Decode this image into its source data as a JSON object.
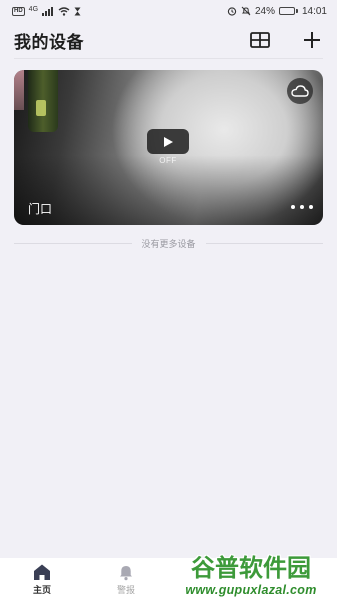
{
  "status_bar": {
    "network_badge": "HD",
    "signal_text": "4G",
    "battery": "24%",
    "battery_level": 0.24,
    "time": "14:01",
    "icons": [
      "hd-icon",
      "signal-icon",
      "wifi-icon",
      "hourglass-icon",
      "alarm-icon",
      "mute-icon",
      "battery-icon"
    ]
  },
  "header": {
    "title": "我的设备",
    "actions": [
      "grid-view-icon",
      "add-icon"
    ]
  },
  "device": {
    "name": "门口",
    "status": "OFF",
    "icons": [
      "cloud-icon",
      "play-icon",
      "more-icon"
    ]
  },
  "list_footer": {
    "text": "没有更多设备"
  },
  "bottom_nav": {
    "items": [
      {
        "label": "主页",
        "icon": "home-icon",
        "active": true
      },
      {
        "label": "警报",
        "icon": "bell-icon",
        "active": false
      }
    ]
  },
  "watermark": {
    "name": "谷普软件园",
    "url": "www.gupuxlazal.com"
  },
  "colors": {
    "background": "#f1f0f6",
    "nav_active": "#333333",
    "nav_inactive": "#a5a5a5",
    "watermark": "#3d9a3a"
  }
}
